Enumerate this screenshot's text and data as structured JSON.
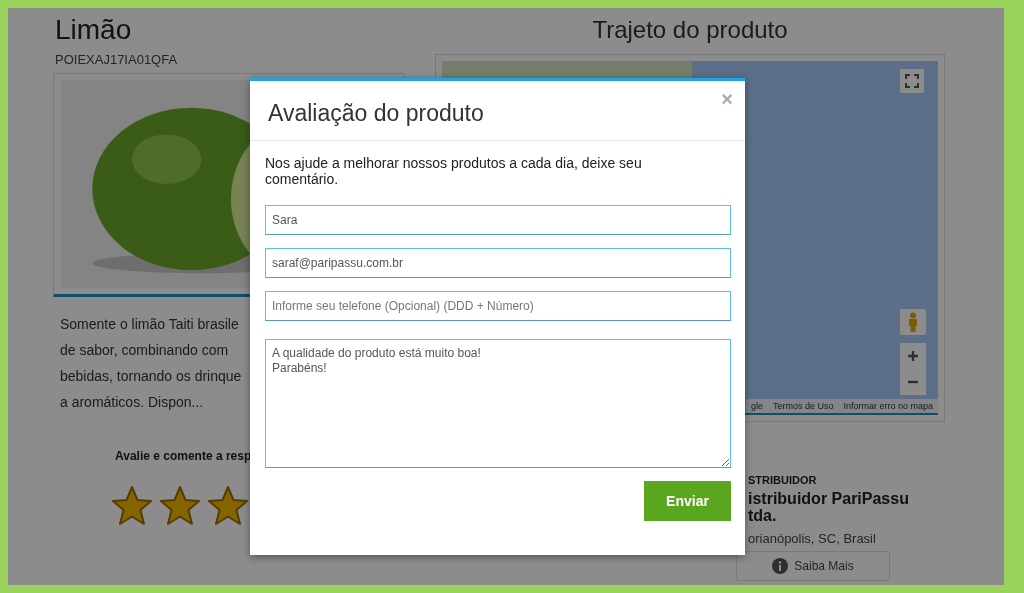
{
  "product": {
    "name": "Limão",
    "code": "POIEXAJ17IA01QFA",
    "description_lines": [
      "Somente o limão Taiti brasile",
      "de sabor, combinando com",
      "bebidas, tornando os drinque",
      "a aromáticos. Dispon..."
    ]
  },
  "rating": {
    "prompt": "Avalie e comente a resp",
    "stars": 3
  },
  "route": {
    "title": "Trajeto do produto",
    "map_links": [
      "gle",
      "Termos de Uso",
      "Informar erro no mapa"
    ]
  },
  "distributor": {
    "label": "STRIBUIDOR",
    "name_lines": [
      "istribuidor PariPassu",
      "tda."
    ],
    "location": "orianópolis, SC, Brasil",
    "button": "Saiba Mais"
  },
  "modal": {
    "title": "Avaliação do produto",
    "close": "×",
    "intro": "Nos ajude a melhorar nossos produtos a cada dia, deixe seu comentário.",
    "fields": [
      {
        "kind": "input",
        "value": "Sara"
      },
      {
        "kind": "input",
        "value": "saraf@paripassu.com.br"
      },
      {
        "kind": "input",
        "placeholder": "Informe seu telefone (Opcional) (DDD + Número)"
      },
      {
        "kind": "textarea",
        "value": "A qualidade do produto está muito boa!\nParabéns!"
      }
    ],
    "submit": "Enviar"
  }
}
